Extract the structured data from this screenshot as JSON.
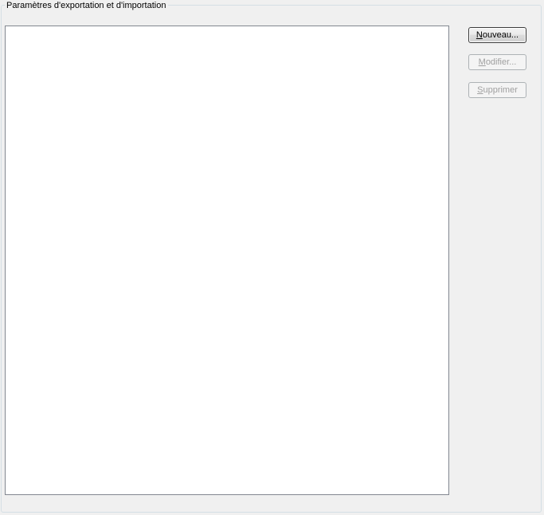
{
  "group": {
    "title": "Paramètres d'exportation et d'importation"
  },
  "buttons": {
    "new": {
      "mnemonic": "N",
      "rest": "ouveau...",
      "enabled": true
    },
    "edit": {
      "mnemonic": "M",
      "rest": "odifier...",
      "enabled": false
    },
    "delete": {
      "mnemonic": "S",
      "rest": "upprimer",
      "enabled": false
    }
  },
  "list": {
    "items": []
  }
}
